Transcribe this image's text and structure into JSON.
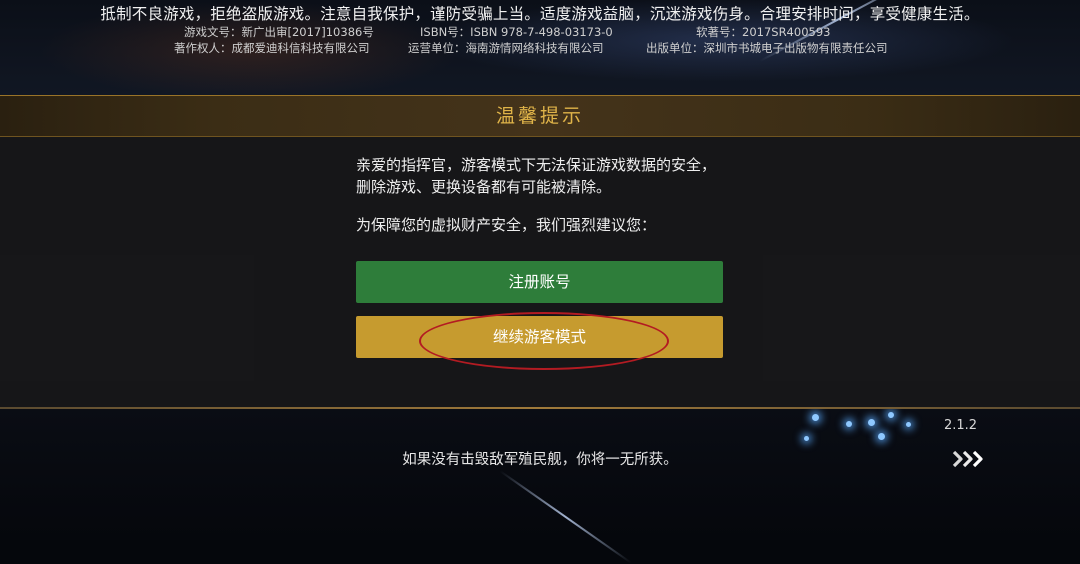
{
  "top_notice": {
    "health_advice": "抵制不良游戏，拒绝盗版游戏。注意自我保护，谨防受骗上当。适度游戏益脑，沉迷游戏伤身。合理安排时间，享受健康生活。",
    "approval_no": "游戏文号：新广出审[2017]10386号",
    "isbn": "ISBN号：ISBN 978-7-498-03173-0",
    "software_no": "软著号：2017SR400593",
    "copyright_holder": "著作权人：成都爱迪科信科技有限公司",
    "operator": "运营单位：海南游情网络科技有限公司",
    "publisher": "出版单位：深圳市书城电子出版物有限责任公司"
  },
  "dialog": {
    "title": "温馨提示",
    "message": "亲爱的指挥官，游客模式下无法保证游戏数据的安全，删除游戏、更换设备都有可能被清除。",
    "advice": "为保障您的虚拟财产安全，我们强烈建议您：",
    "register_button": "注册账号",
    "guest_button": "继续游客模式"
  },
  "footer": {
    "version": "2.1.2",
    "tip": "如果没有击毁敌军殖民舰，你将一无所获。",
    "next_icon": "triple-chevron-right-icon"
  },
  "colors": {
    "title_gold": "#e0b449",
    "register_green": "#2e7d3a",
    "guest_gold": "#c69b2f",
    "annotation_red": "#b31b22"
  }
}
